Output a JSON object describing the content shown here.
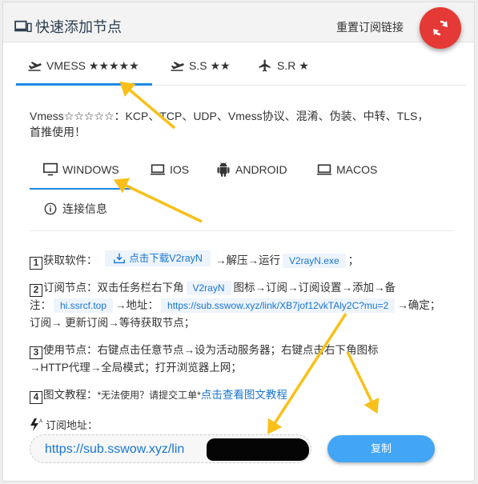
{
  "header": {
    "title": "快速添加节点",
    "reset_link": "重置订阅链接"
  },
  "protocol_tabs": [
    {
      "label": "VMESS ★★★★★",
      "icon": "plane-takeoff-icon",
      "active": true
    },
    {
      "label": "S.S ★★",
      "icon": "plane-takeoff-icon",
      "active": false
    },
    {
      "label": "S.R ★",
      "icon": "airplane-icon",
      "active": false
    }
  ],
  "description": {
    "line1": "Vmess☆☆☆☆☆：KCP、TCP、UDP、Vmess协议、混淆、伪装、中转、TLS，",
    "line2": "首推使用！"
  },
  "os_tabs": [
    {
      "label": "WINDOWS",
      "icon": "monitor-icon",
      "active": true
    },
    {
      "label": "IOS",
      "icon": "laptop-icon",
      "active": false
    },
    {
      "label": "ANDROID",
      "icon": "android-icon",
      "active": false
    },
    {
      "label": "MACOS",
      "icon": "laptop-icon",
      "active": false
    },
    {
      "label": "连接信息",
      "icon": "info-icon",
      "active": false
    }
  ],
  "steps": {
    "s1": {
      "num": "1",
      "label": "获取软件：",
      "download": "点击下载V2rayN",
      "mid": "→解压→运行",
      "exe": "V2rayN.exe",
      "end": "；"
    },
    "s2": {
      "num": "2",
      "label": "订阅节点：双击任务栏右下角",
      "app": "V2rayN",
      "mid": "图标→订阅→订阅设置→添加→备",
      "note_label": "注：",
      "note": "hi.ssrcf.top",
      "addr_label": "→地址：",
      "url": "https://sub.sswow.xyz/link/XB7jof12vkTAly2C?mu=2",
      "confirm": "→确定；",
      "line3": "订阅→ 更新订阅→等待获取节点；"
    },
    "s3": {
      "num": "3",
      "line1": "使用节点：右键点击任意节点→设为活动服务器；右键点击右下角图标",
      "line2": "→HTTP代理→全局模式；打开浏览器上网；"
    },
    "s4": {
      "num": "4",
      "label": "图文教程：",
      "note": "*无法使用？请提交工单*",
      "link": "点击查看图文教程"
    }
  },
  "subscription": {
    "label": "订阅地址：",
    "url_visible": "https://sub.sswow.xyz/lin",
    "url_tail": "/",
    "copy_label": "复制"
  },
  "colors": {
    "accent": "#1e88e5",
    "fab": "#e53935",
    "copy_button": "#42a5f5",
    "annotation_arrow": "#f9c01a"
  }
}
